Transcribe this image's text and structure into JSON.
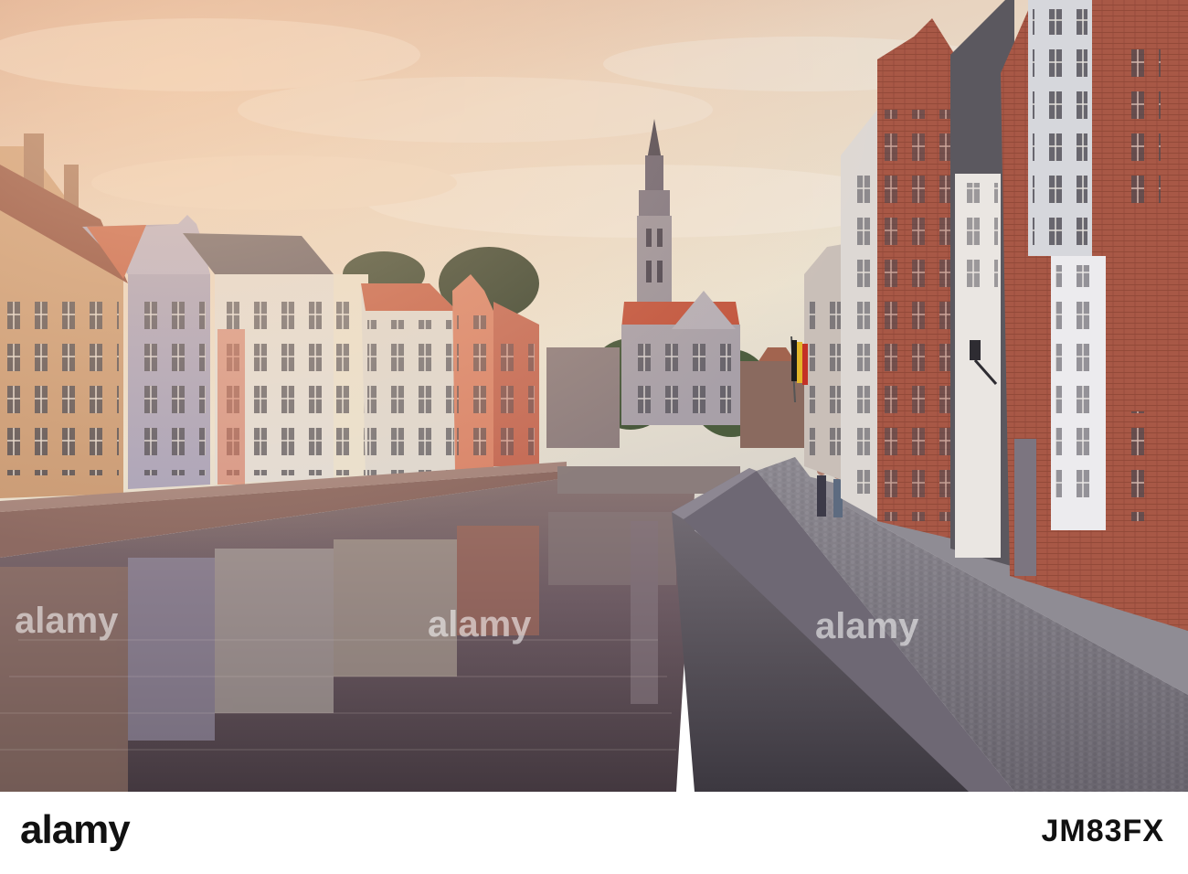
{
  "image": {
    "kind": "photograph",
    "scene": "canal street at sunset"
  },
  "watermarks": [
    {
      "text": "alamy"
    },
    {
      "text": "alamy"
    },
    {
      "text": "alamy"
    }
  ],
  "footer": {
    "brand": "alamy",
    "image_id": "JM83FX"
  },
  "colors": {
    "sky_top": "#d9b39b",
    "sky_mid": "#e6d8c4",
    "brick": "#b0614d",
    "water": "#5d4e58",
    "cobble": "#6e6a73"
  }
}
